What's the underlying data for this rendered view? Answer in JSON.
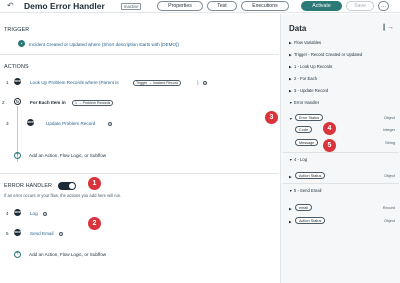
{
  "header": {
    "back_icon": "back-arrow-icon",
    "title": "Demo Error Handler",
    "status_badge": "Inactive",
    "buttons": {
      "properties": "Properties",
      "test": "Test",
      "executions": "Executions",
      "activate": "Activate",
      "save": "Save",
      "more": "…"
    },
    "colors": {
      "primary": "#2b7a78",
      "callout": "#d9343b"
    }
  },
  "trigger": {
    "section_label": "TRIGGER",
    "text": "Incident Created or Updated where (Short description starts with [DEMO])"
  },
  "actions": {
    "section_label": "ACTIONS",
    "items": [
      {
        "index": "1",
        "text": "Look Up Problem Records where (Parent is",
        "pill": "Trigger → Incident Record"
      },
      {
        "index": "2",
        "text": "For Each Item in",
        "pill": "1 → Problem Records"
      },
      {
        "index": "3",
        "text": "Update Problem Record"
      }
    ],
    "add_label": "Add an Action, Flow Logic, or Subflow"
  },
  "error_handler": {
    "section_label": "ERROR HANDLER",
    "hint": "If an error occurs in your flow, the actions you add here will run.",
    "items": [
      {
        "index": "4",
        "text": "Log"
      },
      {
        "index": "5",
        "text": "Send Email"
      }
    ],
    "add_label": "Add an Action, Flow Logic, or Subflow"
  },
  "callouts": [
    "1",
    "2",
    "3",
    "4",
    "5"
  ],
  "data_panel": {
    "title": "Data",
    "sections": {
      "flow_variables": "Flow Variables",
      "trigger": "Trigger - Record Created or Updated",
      "lookup": "1 - Look Up Records",
      "for_each": "2 - For Each",
      "update": "3 - Update Record",
      "error_handler": "Error Handler",
      "log": "4 - Log",
      "send_email": "5 - Send Email"
    },
    "error_status": {
      "label": "Error Status",
      "type": "Object"
    },
    "code": {
      "label": "Code",
      "type": "Integer"
    },
    "message": {
      "label": "Message",
      "type": "String"
    },
    "log_action_status": {
      "label": "Action Status",
      "type": "Object"
    },
    "email": {
      "label": "email",
      "type": "Record"
    },
    "email_action_status": {
      "label": "Action Status",
      "type": "Object"
    }
  }
}
